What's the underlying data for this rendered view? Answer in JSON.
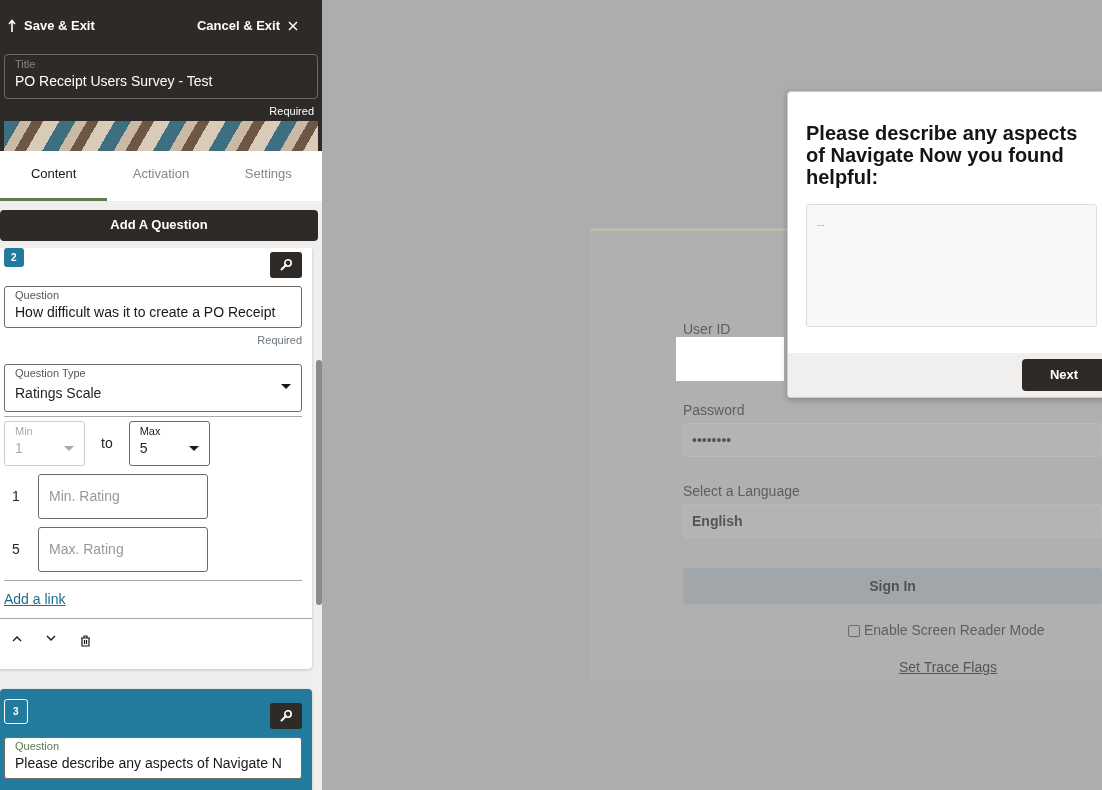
{
  "header": {
    "save_label": "Save & Exit",
    "cancel_label": "Cancel & Exit"
  },
  "title_field": {
    "label": "Title",
    "value": "PO Receipt Users Survey - Test",
    "hint": "Required"
  },
  "tabs": [
    {
      "label": "Content",
      "selected": true
    },
    {
      "label": "Activation",
      "selected": false
    },
    {
      "label": "Settings",
      "selected": false
    }
  ],
  "add_button": "Add A Question",
  "questions": [
    {
      "number": "2",
      "selected": false,
      "question_label": "Question",
      "question_value": "How difficult was it to create a PO Receipt",
      "hint": "Required",
      "type_label": "Question Type",
      "type_value": "Ratings Scale",
      "min": {
        "label": "Min",
        "value": "1",
        "disabled": true
      },
      "to_label": "to",
      "max": {
        "label": "Max",
        "value": "5",
        "disabled": false
      },
      "rating_rows": [
        {
          "number": "1",
          "placeholder": "Min. Rating"
        },
        {
          "number": "5",
          "placeholder": "Max. Rating"
        }
      ],
      "link": "Add a link"
    },
    {
      "number": "3",
      "selected": true,
      "question_label": "Question",
      "question_value": "Please describe any aspects of Navigate N"
    }
  ],
  "background_form": {
    "user_label": "User ID",
    "password_label": "Password",
    "password_value": "••••••••",
    "language_label": "Select a Language",
    "language_value": "English",
    "sign_in": "Sign In",
    "screen_reader": "Enable Screen Reader Mode",
    "screen_reader_checked": false,
    "trace_link": "Set Trace Flags"
  },
  "dialog": {
    "title": "Please describe any aspects of Navigate Now you found helpful:",
    "placeholder": "...",
    "button": "Next"
  }
}
